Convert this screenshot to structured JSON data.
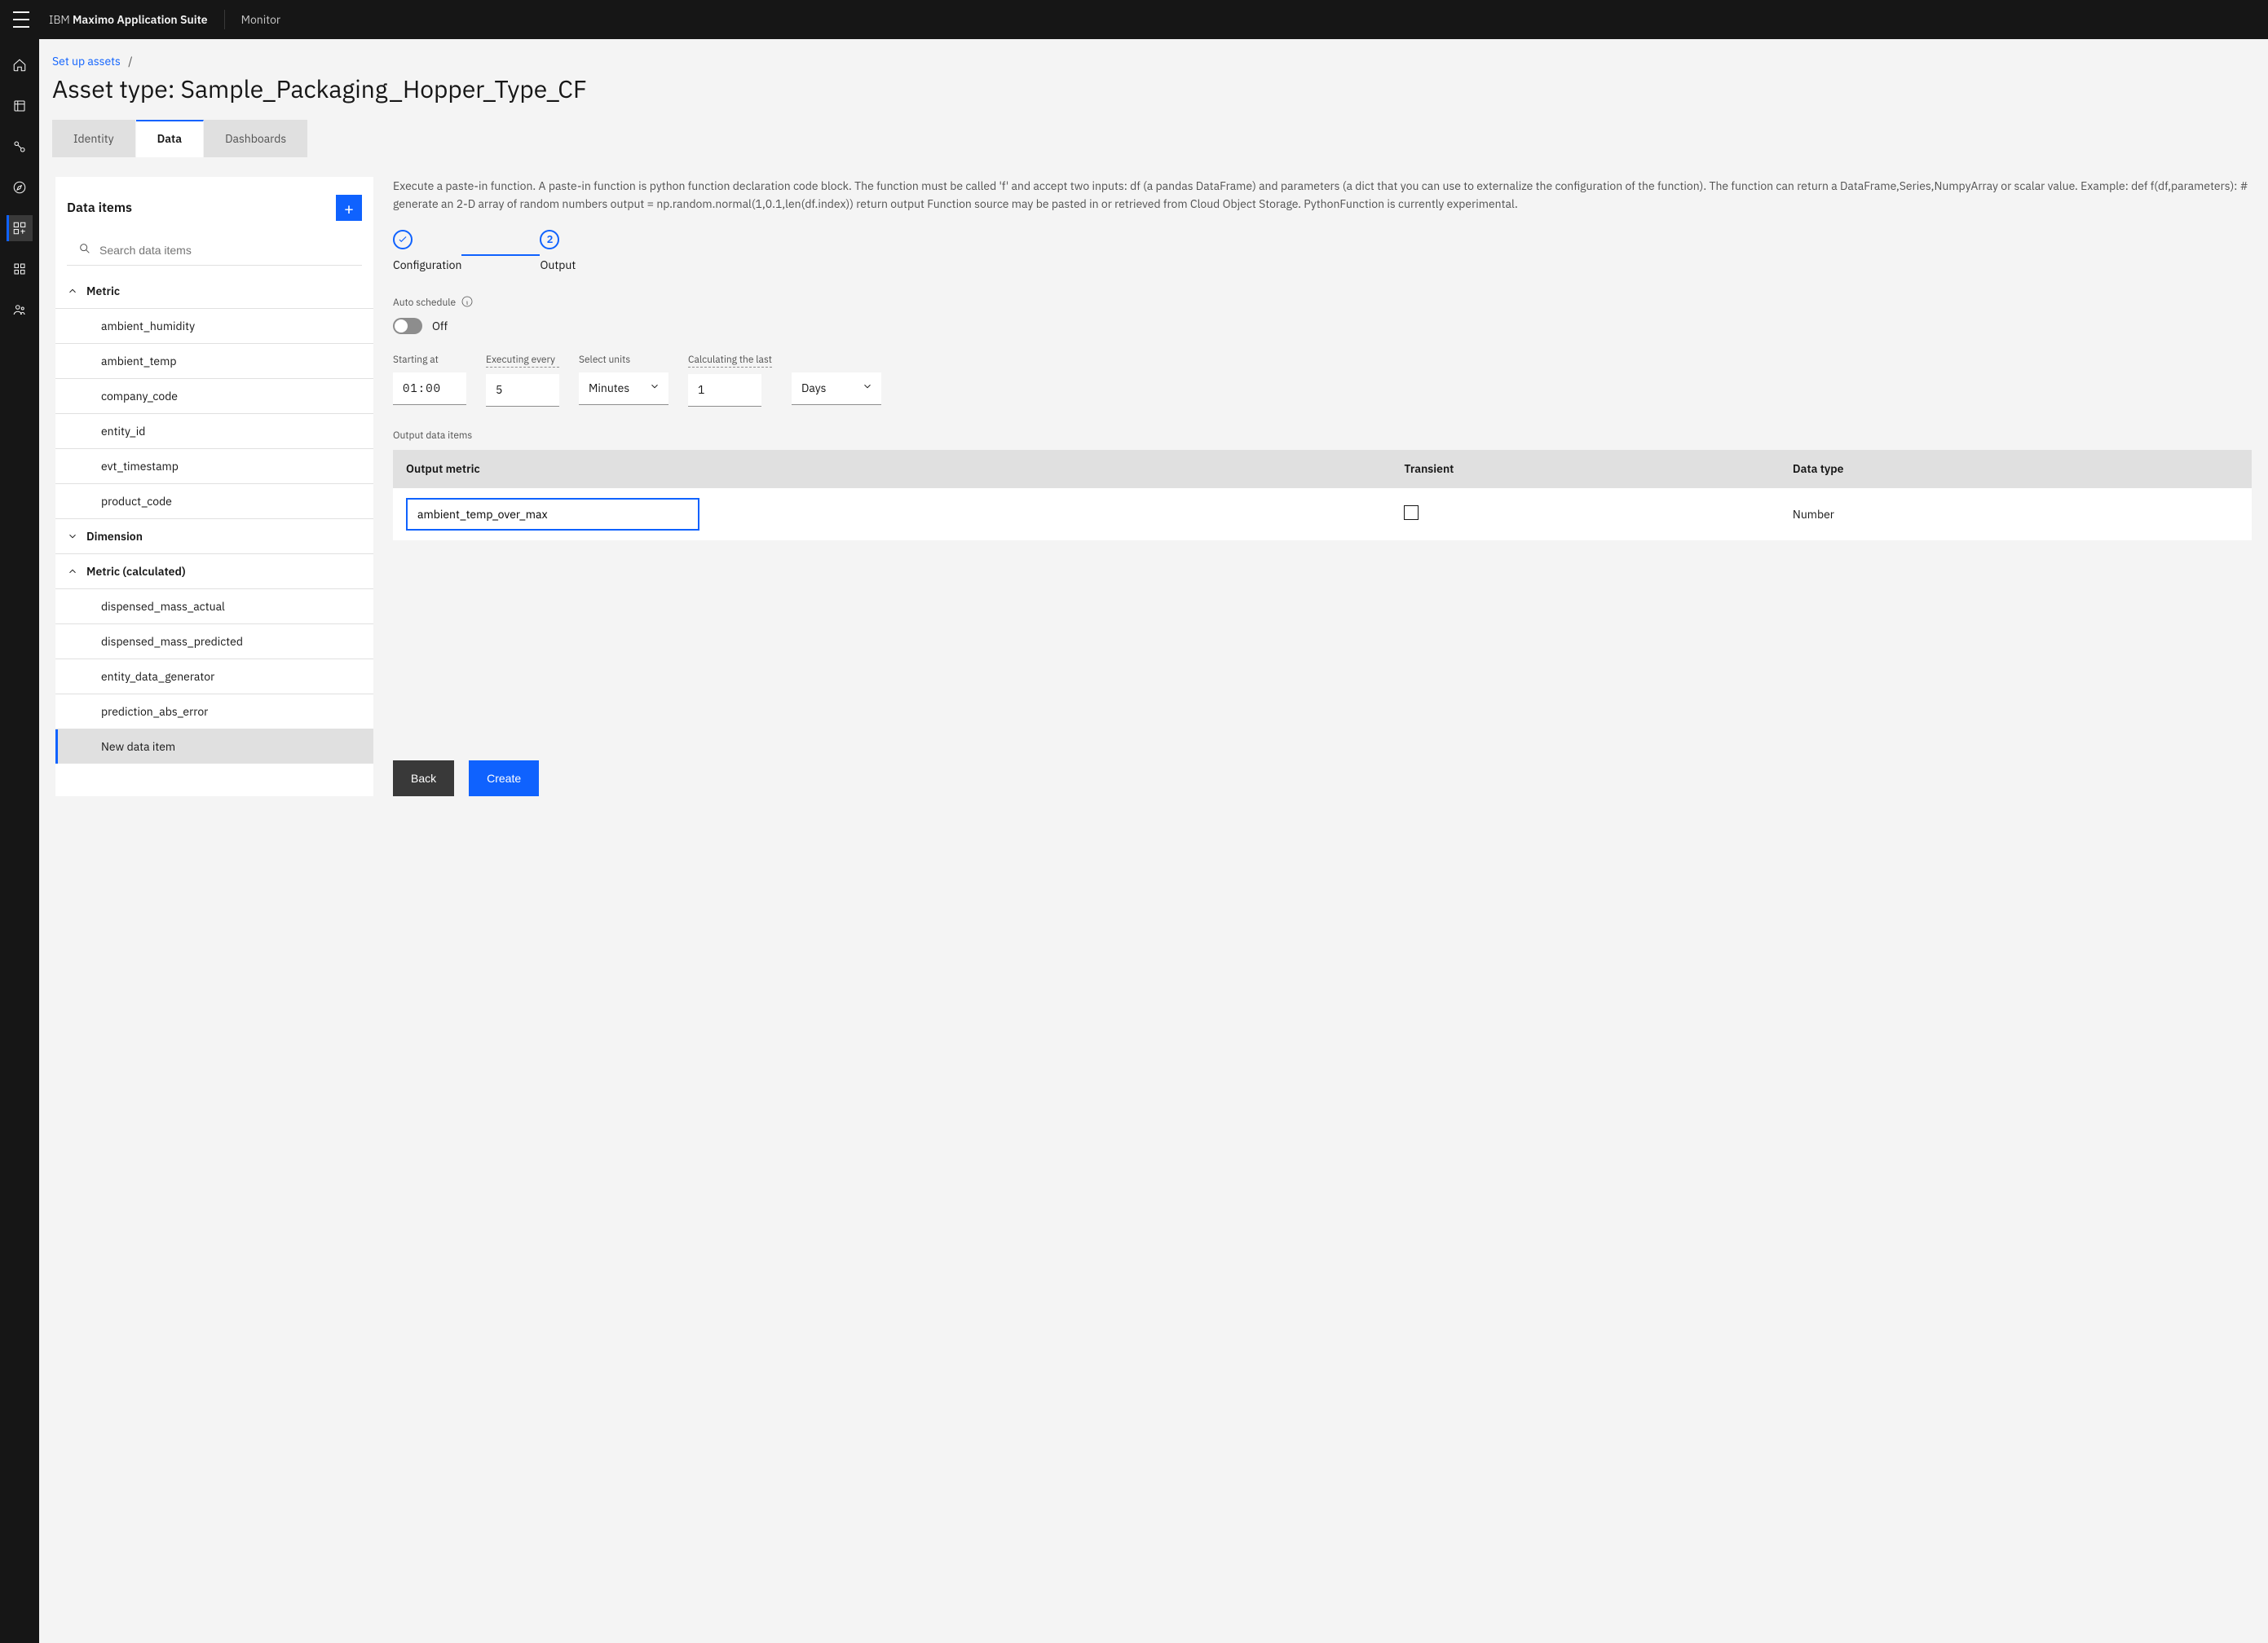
{
  "header": {
    "brand_prefix": "IBM ",
    "brand_bold": "Maximo Application Suite",
    "section": "Monitor"
  },
  "leftnav": {
    "items": [
      "home",
      "data",
      "tag",
      "compass",
      "assets",
      "apps",
      "users"
    ],
    "active_index": 4
  },
  "breadcrumb": {
    "link": "Set up assets",
    "sep": "/"
  },
  "page_title": "Asset type: Sample_Packaging_Hopper_Type_CF",
  "tabs": {
    "items": [
      "Identity",
      "Data",
      "Dashboards"
    ],
    "active_index": 1
  },
  "data_items_panel": {
    "title": "Data items",
    "search_placeholder": "Search data items",
    "groups": [
      {
        "label": "Metric",
        "expanded": true,
        "items": [
          "ambient_humidity",
          "ambient_temp",
          "company_code",
          "entity_id",
          "evt_timestamp",
          "product_code"
        ]
      },
      {
        "label": "Dimension",
        "expanded": false,
        "items": []
      },
      {
        "label": "Metric (calculated)",
        "expanded": true,
        "items": [
          "dispensed_mass_actual",
          "dispensed_mass_predicted",
          "entity_data_generator",
          "prediction_abs_error",
          "New data item"
        ]
      }
    ],
    "selected": "New data item"
  },
  "main_form": {
    "description": "Execute a paste-in function. A paste-in function is python function declaration code block. The function must be called 'f' and accept two inputs: df (a pandas DataFrame) and parameters (a dict that you can use to externalize the configuration of the function). The function can return a DataFrame,Series,NumpyArray or scalar value. Example: def f(df,parameters): # generate an 2-D array of random numbers output = np.random.normal(1,0.1,len(df.index)) return output Function source may be pasted in or retrieved from Cloud Object Storage. PythonFunction is currently experimental.",
    "steps": {
      "items": [
        "Configuration",
        "Output"
      ],
      "current_index": 1
    },
    "auto_schedule_label": "Auto schedule",
    "toggle_state": "Off",
    "schedule": {
      "starting_at": {
        "label": "Starting at",
        "value": "01:00"
      },
      "executing_every": {
        "label": "Executing every",
        "value": "5"
      },
      "select_units": {
        "label": "Select units",
        "value": "Minutes"
      },
      "calculating_last": {
        "label": "Calculating the last",
        "value": "1"
      },
      "calc_units": {
        "value": "Days"
      }
    },
    "output_section_label": "Output data items",
    "table": {
      "headers": [
        "Output metric",
        "Transient",
        "Data type"
      ],
      "row": {
        "metric": "ambient_temp_over_max",
        "transient": false,
        "datatype": "Number"
      }
    },
    "buttons": {
      "back": "Back",
      "create": "Create"
    }
  }
}
